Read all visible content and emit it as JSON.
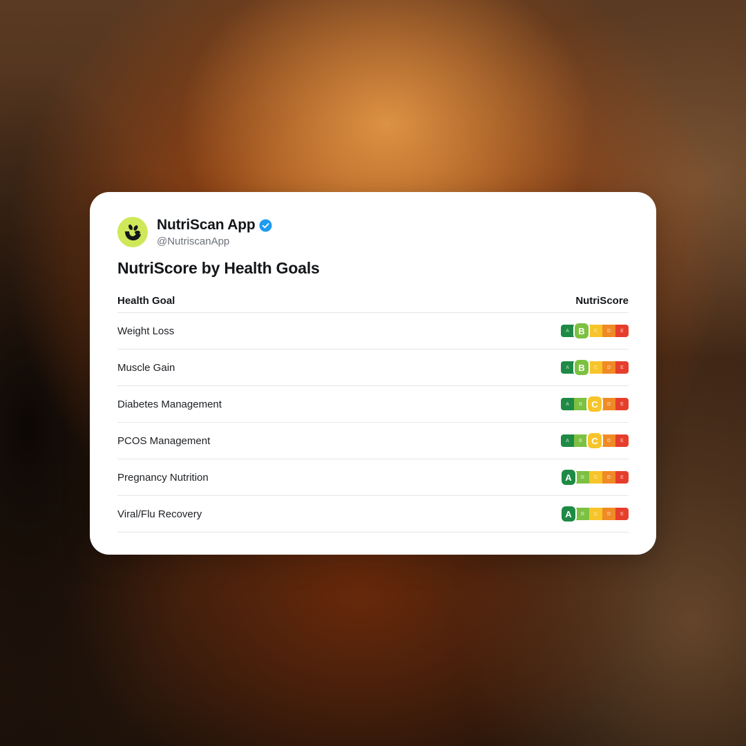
{
  "profile": {
    "display_name": "NutriScan App",
    "handle": "@NutriscanApp",
    "avatar_icon": "nutriscan-logo-icon",
    "verified_icon": "verified-badge-icon",
    "avatar_color": "#cfe85a",
    "verified_color": "#1d9bf0"
  },
  "post": {
    "title": "NutriScore by Health Goals"
  },
  "table": {
    "headers": {
      "goal": "Health Goal",
      "score": "NutriScore"
    },
    "scale": [
      "A",
      "B",
      "C",
      "D",
      "E"
    ],
    "scale_colors": [
      "#1e8a45",
      "#7cc142",
      "#f7c52a",
      "#f08a24",
      "#e63e2c"
    ],
    "rows": [
      {
        "goal": "Weight Loss",
        "score": "B"
      },
      {
        "goal": "Muscle Gain",
        "score": "B"
      },
      {
        "goal": "Diabetes Management",
        "score": "C"
      },
      {
        "goal": "PCOS Management",
        "score": "C"
      },
      {
        "goal": "Pregnancy Nutrition",
        "score": "A"
      },
      {
        "goal": "Viral/Flu Recovery",
        "score": "A"
      }
    ]
  }
}
